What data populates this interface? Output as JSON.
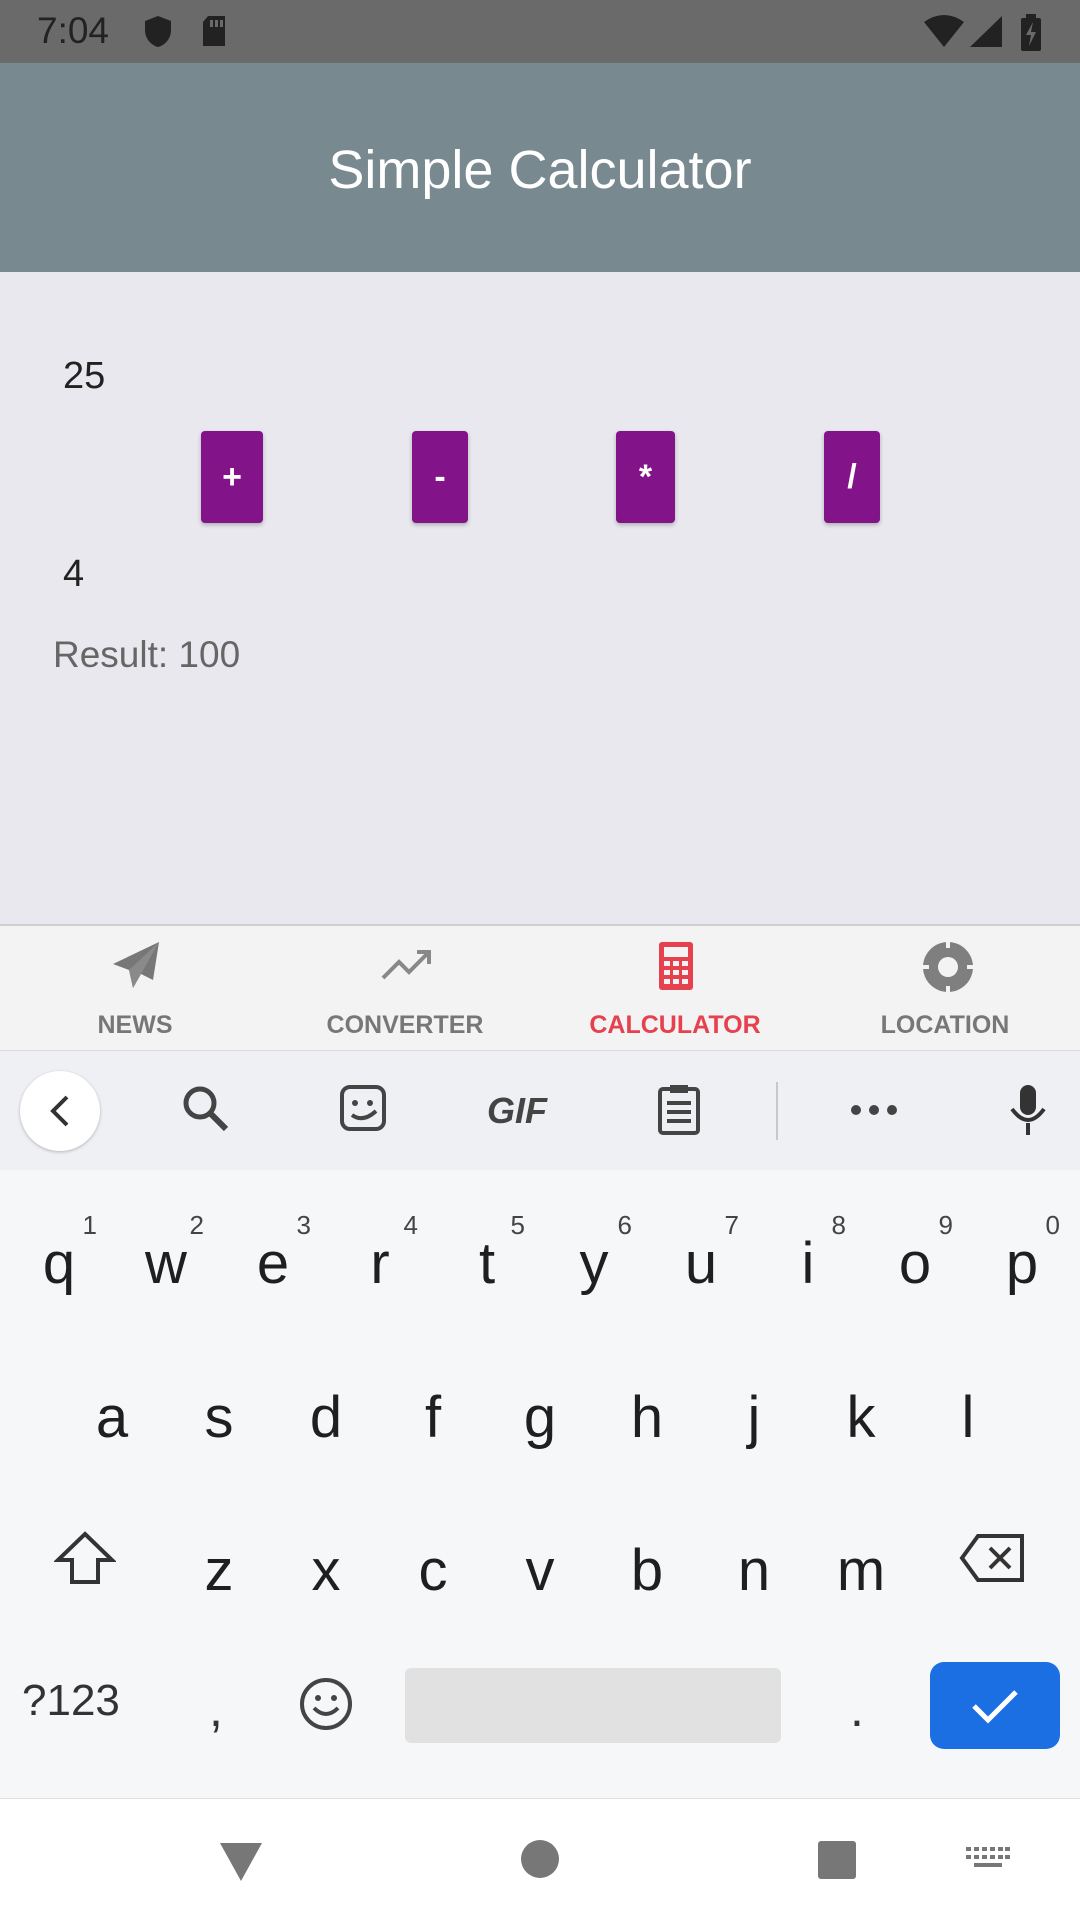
{
  "status_bar": {
    "time": "7:04",
    "left_icons": [
      "shield-icon",
      "sd-card-icon"
    ],
    "right_icons": [
      "wifi-icon",
      "cellular-signal-icon",
      "battery-charging-icon"
    ]
  },
  "app_bar": {
    "title": "Simple Calculator"
  },
  "calculator": {
    "first_number": "25",
    "second_number": "4",
    "operators": [
      "+",
      "-",
      "*",
      "/"
    ],
    "result_text": "Result: 100",
    "button_color": "#821388"
  },
  "bottom_nav": {
    "active_color": "#e5414e",
    "items": [
      {
        "label": "NEWS",
        "icon": "paper-plane-icon",
        "active": false
      },
      {
        "label": "CONVERTER",
        "icon": "trending-up-icon",
        "active": false
      },
      {
        "label": "CALCULATOR",
        "icon": "calculator-icon",
        "active": true
      },
      {
        "label": "LOCATION",
        "icon": "location-target-icon",
        "active": false
      }
    ]
  },
  "keyboard": {
    "toolbar_icons": [
      "back-chevron-icon",
      "search-icon",
      "sticker-icon",
      "gif-icon",
      "clipboard-icon",
      "more-icon",
      "microphone-icon"
    ],
    "gif_label": "GIF",
    "row1": [
      [
        "q",
        "1"
      ],
      [
        "w",
        "2"
      ],
      [
        "e",
        "3"
      ],
      [
        "r",
        "4"
      ],
      [
        "t",
        "5"
      ],
      [
        "y",
        "6"
      ],
      [
        "u",
        "7"
      ],
      [
        "i",
        "8"
      ],
      [
        "o",
        "9"
      ],
      [
        "p",
        "0"
      ]
    ],
    "row2": [
      "a",
      "s",
      "d",
      "f",
      "g",
      "h",
      "j",
      "k",
      "l"
    ],
    "row3": [
      "z",
      "x",
      "c",
      "v",
      "b",
      "n",
      "m"
    ],
    "symbols_key": "?123",
    "comma_key": ",",
    "period_key": ".",
    "enter_color": "#1c6ee3"
  },
  "system_nav": [
    "back-triangle-icon",
    "home-circle-icon",
    "recents-square-icon",
    "keyboard-switch-icon"
  ]
}
